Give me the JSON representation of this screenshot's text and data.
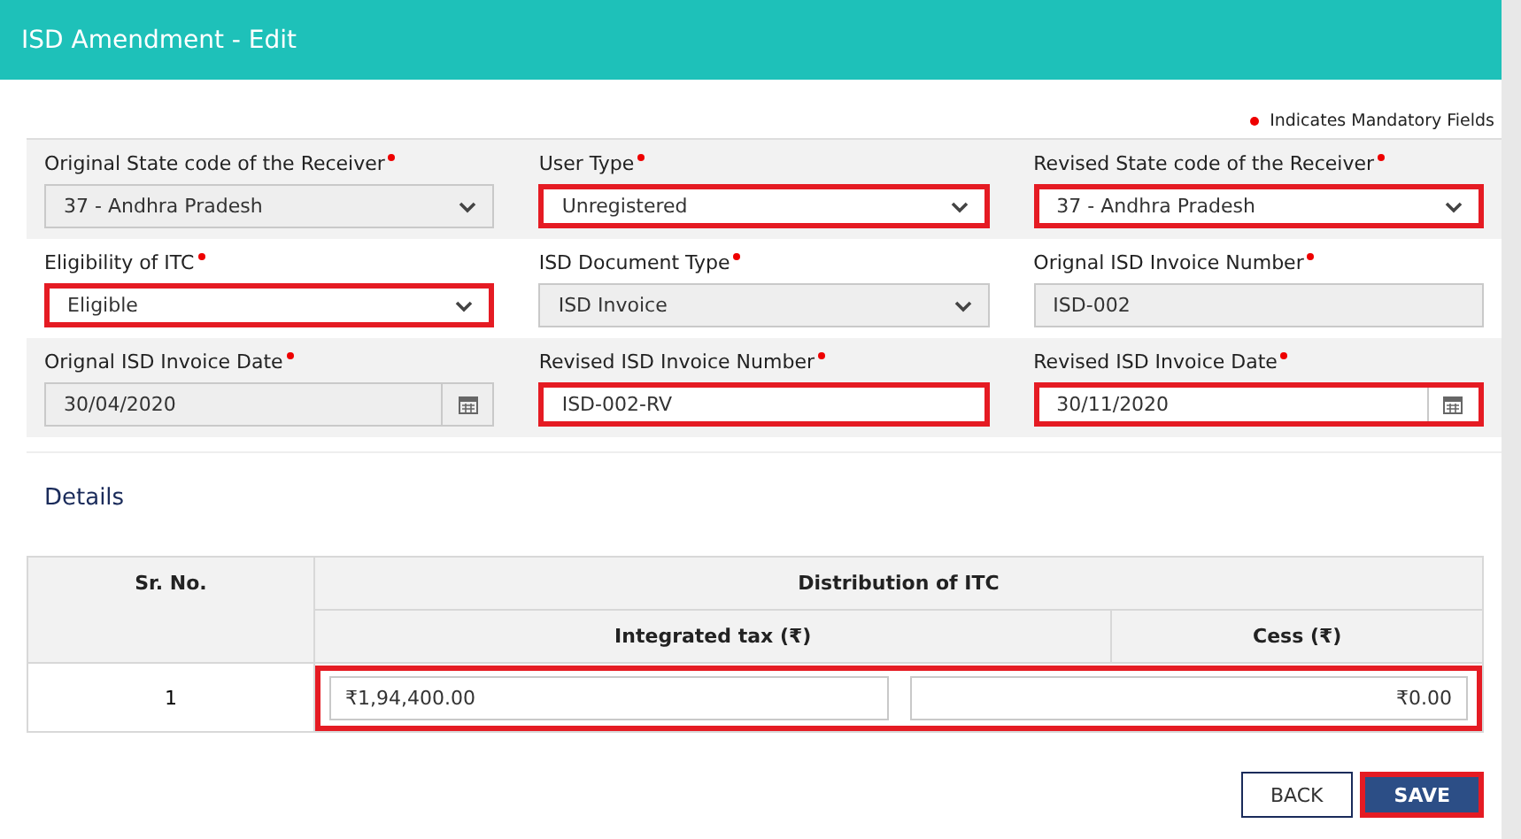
{
  "header": {
    "title": "ISD Amendment - Edit"
  },
  "mandatory_note": "Indicates Mandatory Fields",
  "form_rows": [
    {
      "shaded": true,
      "fields": [
        {
          "label": "Original State code of the Receiver",
          "kind": "select",
          "value": "37 - Andhra Pradesh",
          "disabled": true,
          "highlighted": false
        },
        {
          "label": "User Type",
          "kind": "select",
          "value": "Unregistered",
          "disabled": false,
          "highlighted": true
        },
        {
          "label": "Revised State code of the Receiver",
          "kind": "select",
          "value": "37 - Andhra Pradesh",
          "disabled": false,
          "highlighted": true
        }
      ]
    },
    {
      "shaded": false,
      "fields": [
        {
          "label": "Eligibility of ITC",
          "kind": "select",
          "value": "Eligible",
          "disabled": false,
          "highlighted": true
        },
        {
          "label": "ISD Document Type",
          "kind": "select",
          "value": "ISD Invoice",
          "disabled": true,
          "highlighted": false
        },
        {
          "label": "Orignal ISD Invoice Number",
          "kind": "input",
          "value": "ISD-002",
          "disabled": true,
          "highlighted": false
        }
      ]
    },
    {
      "shaded": true,
      "fields": [
        {
          "label": "Orignal ISD Invoice Date",
          "kind": "date",
          "value": "30/04/2020",
          "disabled": true,
          "highlighted": false
        },
        {
          "label": "Revised ISD Invoice Number",
          "kind": "input",
          "value": "ISD-002-RV",
          "disabled": false,
          "highlighted": true
        },
        {
          "label": "Revised ISD Invoice Date",
          "kind": "date",
          "value": "30/11/2020",
          "disabled": false,
          "highlighted": true
        }
      ]
    }
  ],
  "details": {
    "title": "Details",
    "table": {
      "sr_header": "Sr. No.",
      "group_header": "Distribution of ITC",
      "columns": [
        "Integrated tax (₹)",
        "Cess (₹)"
      ],
      "rows": [
        {
          "sr": "1",
          "values": [
            "₹1,94,400.00",
            "₹0.00"
          ],
          "highlighted": true
        }
      ]
    }
  },
  "buttons": [
    {
      "label": "BACK",
      "kind": "secondary",
      "highlighted": false
    },
    {
      "label": "SAVE",
      "kind": "primary",
      "highlighted": true
    }
  ]
}
